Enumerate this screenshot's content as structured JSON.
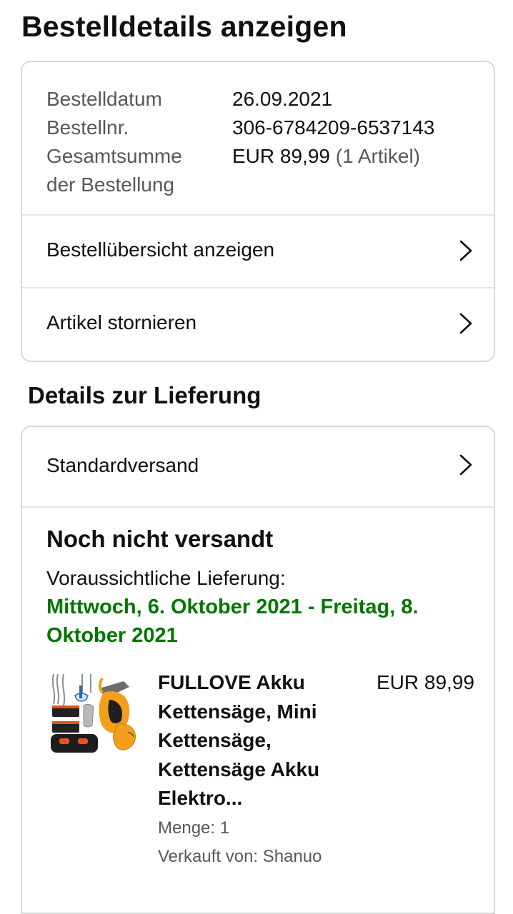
{
  "page": {
    "title": "Bestelldetails anzeigen"
  },
  "order_info": {
    "date_label": "Bestelldatum",
    "date_value": "26.09.2021",
    "number_label": "Bestellnr.",
    "number_value": "306-6784209-6537143",
    "total_label_line1": "Gesamtsumme",
    "total_label_line2": "der Bestellung",
    "total_value": "EUR 89,99",
    "total_items": "(1 Artikel)"
  },
  "order_links": [
    {
      "label": "Bestellübersicht anzeigen",
      "icon": "chevron-right-icon"
    },
    {
      "label": "Artikel stornieren",
      "icon": "chevron-right-icon"
    }
  ],
  "delivery": {
    "section_title": "Details zur Lieferung",
    "shipping_method": "Standardversand",
    "shipping_icon": "chevron-right-icon",
    "status": "Noch nicht versandt",
    "estimate_label": "Voraussichtliche Lieferung:",
    "estimate_date": "Mittwoch, 6. Oktober 2021 - Freitag, 8. Oktober 2021",
    "estimate_color": "#007600"
  },
  "product": {
    "image_icon": "chainsaw-product-image",
    "title": "FULLOVE Akku Kettensäge, Mini Kettensäge, Kettensäge Akku Elektro...",
    "price": "EUR 89,99",
    "quantity": "Menge: 1",
    "seller": "Verkauft von: Shanuo"
  },
  "colors": {
    "text": "#0f1111",
    "muted": "#565959",
    "border": "#d5d9d9",
    "accent_green": "#007600"
  }
}
